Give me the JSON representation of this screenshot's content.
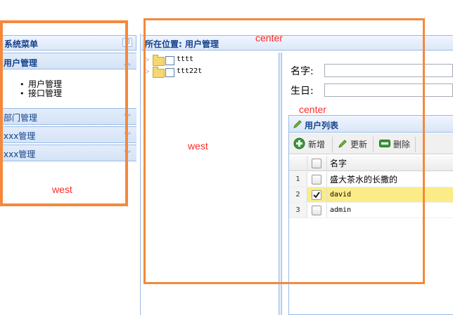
{
  "west": {
    "title": "系统菜单",
    "collapse_glyph": "⊡",
    "accordion": [
      {
        "label": "用户管理",
        "expanded": true
      },
      {
        "label": "部门管理",
        "expanded": false
      },
      {
        "label": "xxx管理",
        "expanded": false
      },
      {
        "label": "xxx管理",
        "expanded": false
      }
    ],
    "menu_items": [
      "用户管理",
      "接口管理"
    ]
  },
  "center": {
    "breadcrumb": "所在位置: 用户管理",
    "tree": [
      {
        "label": "tttt"
      },
      {
        "label": "ttt22t"
      }
    ],
    "form": {
      "name_label": "名字:",
      "birthday_label": "生日:"
    },
    "grid": {
      "title": "用户列表",
      "toolbar": {
        "add": "新增",
        "update": "更新",
        "delete": "删除"
      },
      "column_name": "名字",
      "rows": [
        {
          "num": "1",
          "name": "盛大茶水的长撒的",
          "checked": false,
          "selected": false
        },
        {
          "num": "2",
          "name": "david",
          "checked": true,
          "selected": true
        },
        {
          "num": "3",
          "name": "admin",
          "checked": false,
          "selected": false
        }
      ]
    }
  },
  "annotations": {
    "west_left": "west",
    "center_top": "center",
    "west_inner": "west",
    "center_inner": "center"
  },
  "colors": {
    "annotation_border": "#f5883b",
    "annotation_text": "#ff2a2a",
    "panel_title": "#15428b",
    "selected_row": "#fbec88"
  }
}
